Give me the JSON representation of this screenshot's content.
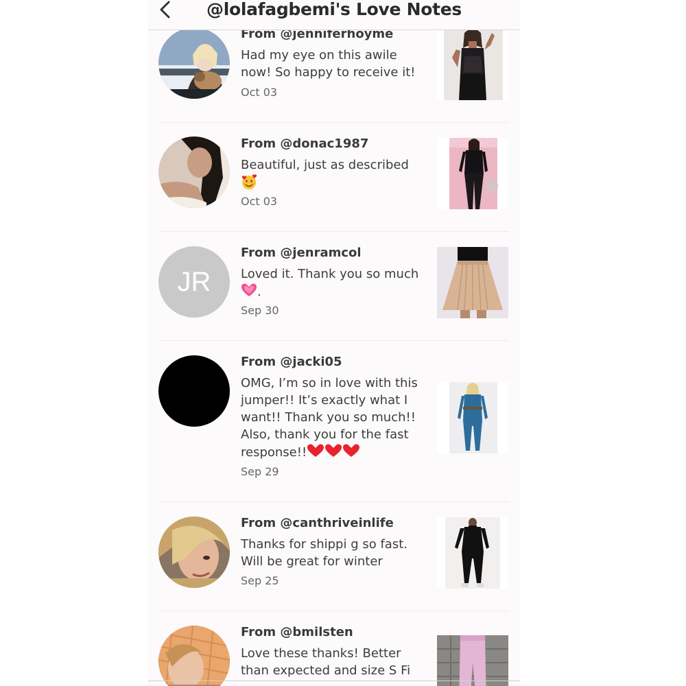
{
  "header": {
    "title": "@lolafagbemi's Love Notes",
    "back_icon": "chevron-left-icon"
  },
  "notes": [
    {
      "from": "From @jenniferhoyme",
      "message": "Had my eye on this awile now! So happy to receive it!",
      "date": "Oct 03",
      "avatar": "photo"
    },
    {
      "from": "From @donac1987",
      "message": "Beautiful, just as described",
      "emoji": "smiling-face-with-hearts",
      "date": "Oct 03",
      "avatar": "photo"
    },
    {
      "from": "From @jenramcol",
      "message": "Loved it. Thank you so much",
      "emoji": "growing-heart",
      "message_suffix": ".",
      "date": "Sep 30",
      "avatar_initials": "JR"
    },
    {
      "from": "From @jacki05",
      "message": "OMG, I’m so in love with this jumper!! It’s exactly what I want!! Thank you so much!! Also, thank you for the fast response!!",
      "emoji": "red-heart x3",
      "date": "Sep 29",
      "avatar": "black-circle"
    },
    {
      "from": "From @canthriveinlife",
      "message": "Thanks for shippi g so fast. Will be great for winter",
      "date": "Sep 25",
      "avatar": "photo"
    },
    {
      "from": "From @bmilsten",
      "message": "Love these thanks! Better than expected and size S Fi",
      "date": "",
      "avatar": "photo"
    }
  ],
  "colors": {
    "background": "#fcfafb",
    "heart_red": "#e8232d",
    "heart_pink": "#f0508e"
  }
}
